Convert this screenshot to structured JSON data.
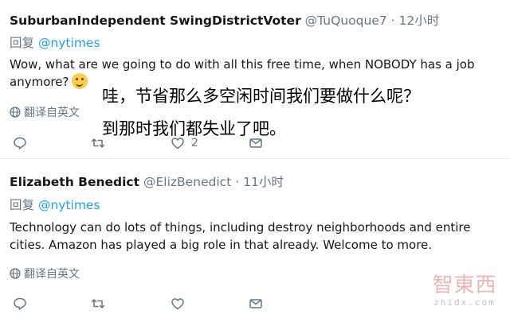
{
  "tweets": [
    {
      "author_name": "SuburbanIndependent SwingDistrictVoter",
      "handle": "@TuQuoque7",
      "separator": "·",
      "time": "12小时",
      "reply_prefix": "回复 ",
      "reply_to": "@nytimes",
      "body_lines": [
        "Wow, what are we going to do with all this free time,  when NOBODY has a job",
        "anymore?"
      ],
      "emoji": "thinking-face-emoji",
      "translate_label": "翻译自英文",
      "like_count": "2",
      "overlay_lines": [
        "哇，节省那么多空闲时间我们要做什么呢？",
        "到那时我们都失业了吧。"
      ]
    },
    {
      "author_name": "Elizabeth Benedict",
      "handle": "@ElizBenedict",
      "separator": "·",
      "time": "11小时",
      "reply_prefix": "回复 ",
      "reply_to": "@nytimes",
      "body_lines": [
        "Technology can do lots of things, including destroy neighborhoods and entire",
        "cities. Amazon has played a big role in that already. Welcome to more."
      ],
      "translate_label": "翻译自英文",
      "like_count": ""
    }
  ],
  "watermark": {
    "logo": "智東西",
    "sub": "zhidx.com"
  },
  "colors": {
    "link": "#1da1f2",
    "muted": "#657786",
    "text": "#14171a"
  }
}
